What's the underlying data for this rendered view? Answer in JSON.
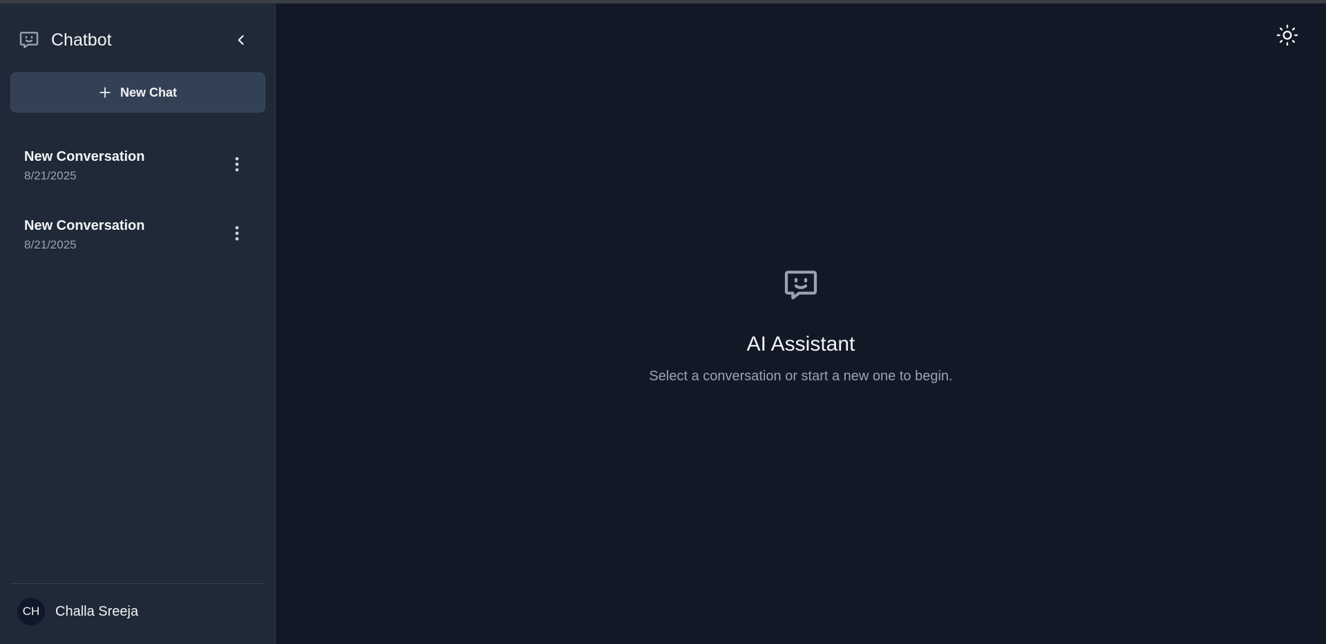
{
  "sidebar": {
    "brand": {
      "title": "Chatbot",
      "icon": "chat-bubble-smile-icon"
    },
    "collapse_icon": "chevron-left-icon",
    "new_chat": {
      "label": "New Chat",
      "icon": "plus-icon"
    },
    "conversations": [
      {
        "title": "New Conversation",
        "date": "8/21/2025",
        "menu_icon": "more-vertical-icon"
      },
      {
        "title": "New Conversation",
        "date": "8/21/2025",
        "menu_icon": "more-vertical-icon"
      }
    ],
    "user": {
      "initials": "CH",
      "name": "Challa Sreeja"
    }
  },
  "header": {
    "theme_toggle_icon": "sun-icon"
  },
  "main": {
    "empty_state": {
      "icon": "chat-bubble-smile-icon",
      "title": "AI Assistant",
      "subtitle": "Select a conversation or start a new one to begin."
    }
  },
  "colors": {
    "main_bg": "#121826",
    "sidebar_bg": "#1f2937",
    "button_bg": "#334155",
    "text_primary": "#f3f4f6",
    "text_muted": "#9ca3af",
    "avatar_bg": "#0f172a"
  }
}
